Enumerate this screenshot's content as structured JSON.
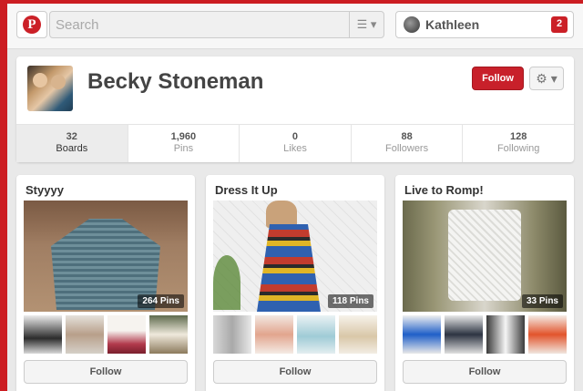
{
  "header": {
    "logo_letter": "P",
    "search_placeholder": "Search",
    "menu_icon": "hamburger-menu-icon",
    "user_name": "Kathleen",
    "notification_count": "2"
  },
  "profile": {
    "name": "Becky Stoneman",
    "follow_label": "Follow",
    "settings_icon": "gear-icon",
    "stats": [
      {
        "num": "32",
        "label": "Boards"
      },
      {
        "num": "1,960",
        "label": "Pins"
      },
      {
        "num": "0",
        "label": "Likes"
      },
      {
        "num": "88",
        "label": "Followers"
      },
      {
        "num": "128",
        "label": "Following"
      }
    ]
  },
  "boards": [
    {
      "title": "Styyyy",
      "pin_count": "264 Pins",
      "follow_label": "Follow"
    },
    {
      "title": "Dress It Up",
      "pin_count": "118 Pins",
      "follow_label": "Follow"
    },
    {
      "title": "Live to Romp!",
      "pin_count": "33 Pins",
      "follow_label": "Follow"
    }
  ],
  "colors": {
    "brand_red": "#cb2027",
    "follow_red": "#c8202a"
  }
}
